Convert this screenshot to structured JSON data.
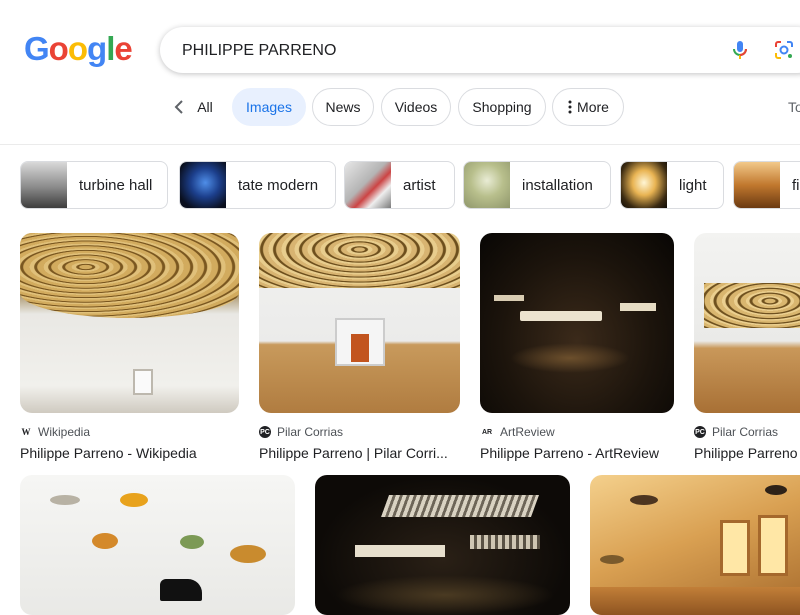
{
  "logo": {
    "letters": [
      "G",
      "o",
      "o",
      "g",
      "l",
      "e"
    ],
    "colors": [
      "#4285f4",
      "#ea4335",
      "#fbbc05",
      "#4285f4",
      "#34a853",
      "#ea4335"
    ]
  },
  "search": {
    "query": "PHILIPPE PARRENO"
  },
  "tabs": {
    "all": "All",
    "images": "Images",
    "news": "News",
    "videos": "Videos",
    "shopping": "Shopping",
    "more": "More",
    "tools": "To"
  },
  "chips": [
    {
      "label": "turbine hall"
    },
    {
      "label": "tate modern"
    },
    {
      "label": "artist"
    },
    {
      "label": "installation"
    },
    {
      "label": "light"
    },
    {
      "label": "fi"
    }
  ],
  "results": [
    {
      "source": "Wikipedia",
      "title": "Philippe Parreno - Wikipedia",
      "icon_text": "W"
    },
    {
      "source": "Pilar Corrias",
      "title": "Philippe Parreno | Pilar Corri...",
      "icon_text": "PC"
    },
    {
      "source": "ArtReview",
      "title": "Philippe Parreno - ArtReview",
      "icon_text": "AR"
    },
    {
      "source": "Pilar Corrias",
      "title": "Philippe Parreno",
      "icon_text": "PC"
    }
  ],
  "colors": {
    "accent": "#1a73e8",
    "active_tab_bg": "#e8f0fe"
  }
}
